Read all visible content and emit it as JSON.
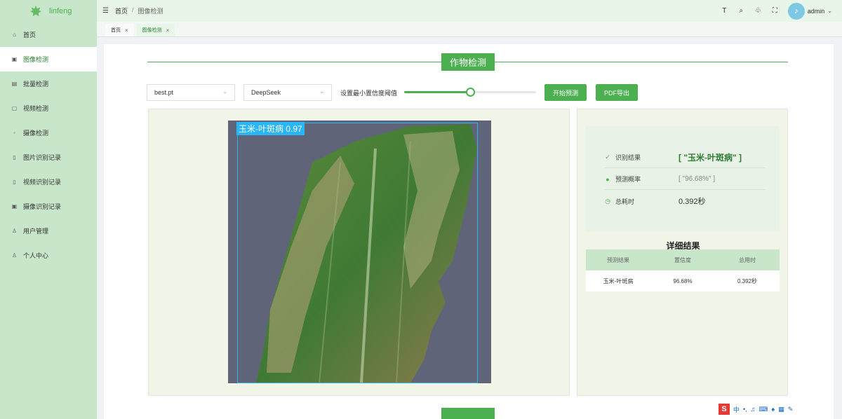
{
  "app": {
    "name": "linfeng"
  },
  "sidebar": {
    "items": [
      {
        "label": "首页",
        "icon": "home-icon"
      },
      {
        "label": "图像检测",
        "icon": "image-icon",
        "active": true
      },
      {
        "label": "批量检测",
        "icon": "batch-icon"
      },
      {
        "label": "视频检测",
        "icon": "video-icon"
      },
      {
        "label": "摄像检测",
        "icon": "camera-icon"
      },
      {
        "label": "图片识别记录",
        "icon": "document-icon"
      },
      {
        "label": "视频识别记录",
        "icon": "file-icon"
      },
      {
        "label": "摄像识别记录",
        "icon": "record-icon"
      },
      {
        "label": "用户管理",
        "icon": "user-icon"
      },
      {
        "label": "个人中心",
        "icon": "person-icon"
      }
    ]
  },
  "header": {
    "breadcrumb": [
      "首页",
      "图像检测"
    ],
    "separator": "/",
    "user": "admin"
  },
  "tabs": [
    {
      "label": "首页",
      "active": false
    },
    {
      "label": "图像检测",
      "active": true
    }
  ],
  "main": {
    "title": "作物检测",
    "model_select": "best.pt",
    "llm_select": "DeepSeek",
    "slider_label": "设置最小置信度阈值",
    "slider_value_fraction": 0.5,
    "predict_button": "开始预测",
    "pdf_button": "PDF导出",
    "bbox_label": "玉米-叶斑病 0.97"
  },
  "result": {
    "rows": [
      {
        "label": "识别结果",
        "value": "[ \"玉米-叶斑病\" ]",
        "icon": "check-icon"
      },
      {
        "label": "预测概率",
        "value": "[ \"96.68%\" ]",
        "icon": "pin-icon"
      },
      {
        "label": "总耗时",
        "value": "0.392秒",
        "icon": "clock-icon"
      }
    ],
    "detail_title": "详细结果",
    "table": {
      "headers": [
        "预测结果",
        "置信度",
        "总用时"
      ],
      "rows": [
        [
          "玉米-叶斑病",
          "96.68%",
          "0.392秒"
        ]
      ]
    }
  },
  "colors": {
    "accent": "#4caf50",
    "sidebar": "#c8e6c9",
    "bbox": "#29b6f6"
  }
}
